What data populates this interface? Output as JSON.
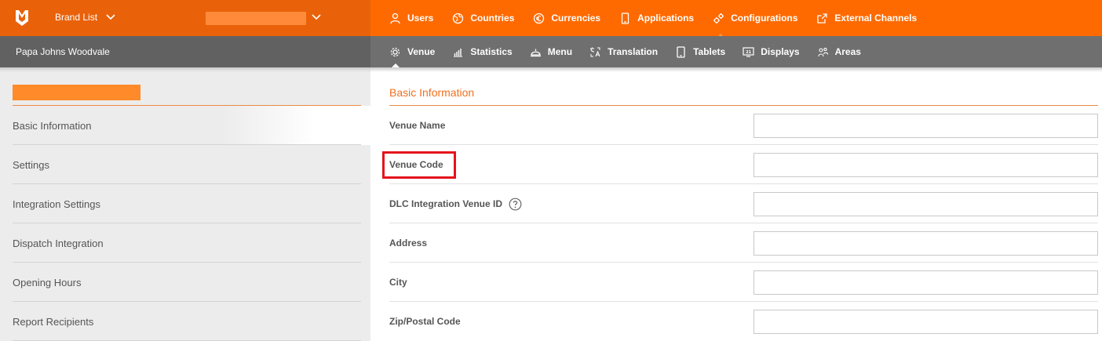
{
  "header": {
    "brand_list_label": "Brand List",
    "nav": [
      {
        "label": "Users",
        "icon": "user-icon"
      },
      {
        "label": "Countries",
        "icon": "globe-icon"
      },
      {
        "label": "Currencies",
        "icon": "euro-icon"
      },
      {
        "label": "Applications",
        "icon": "phone-icon"
      },
      {
        "label": "Configurations",
        "icon": "gears-icon"
      },
      {
        "label": "External Channels",
        "icon": "external-link-icon"
      }
    ]
  },
  "subheader": {
    "venue_name": "Papa Johns Woodvale",
    "nav": [
      {
        "label": "Venue",
        "icon": "gear-icon"
      },
      {
        "label": "Statistics",
        "icon": "chart-icon"
      },
      {
        "label": "Menu",
        "icon": "cloche-icon"
      },
      {
        "label": "Translation",
        "icon": "translate-icon"
      },
      {
        "label": "Tablets",
        "icon": "tablet-icon"
      },
      {
        "label": "Displays",
        "icon": "display-icon"
      },
      {
        "label": "Areas",
        "icon": "areas-icon"
      }
    ]
  },
  "sidebar": {
    "items": [
      {
        "label": "Basic Information"
      },
      {
        "label": "Settings"
      },
      {
        "label": "Integration Settings"
      },
      {
        "label": "Dispatch Integration"
      },
      {
        "label": "Opening Hours"
      },
      {
        "label": "Report Recipients"
      }
    ]
  },
  "main": {
    "section_title": "Basic Information",
    "fields": [
      {
        "label": "Venue Name",
        "value": ""
      },
      {
        "label": "Venue Code",
        "value": ""
      },
      {
        "label": "DLC Integration Venue ID",
        "value": ""
      },
      {
        "label": "Address",
        "value": ""
      },
      {
        "label": "City",
        "value": ""
      },
      {
        "label": "Zip/Postal Code",
        "value": ""
      }
    ]
  },
  "colors": {
    "primary_orange": "#ff6a00",
    "dark_orange": "#e9620a",
    "gray_bar": "#6f6f6f",
    "highlight_red": "#e4141b"
  }
}
